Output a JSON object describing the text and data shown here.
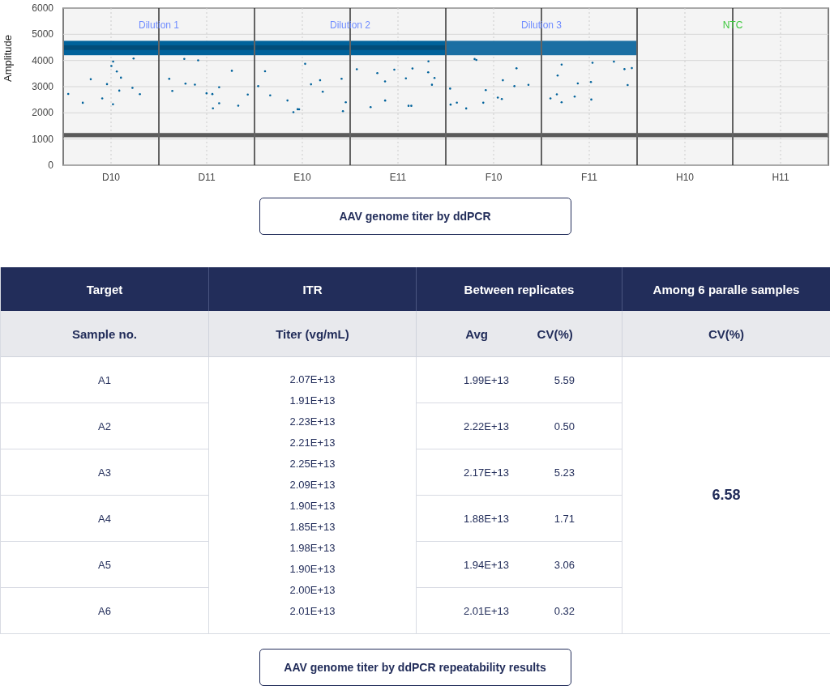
{
  "chart": {
    "ylabel": "Amplitude",
    "yticks": [
      "6000",
      "5000",
      "4000",
      "3000",
      "2000",
      "1000",
      "0"
    ],
    "wells": [
      {
        "label": "D10",
        "positive": true
      },
      {
        "label": "D11",
        "positive": true
      },
      {
        "label": "E10",
        "positive": true
      },
      {
        "label": "E11",
        "positive": true
      },
      {
        "label": "F10",
        "positive": true
      },
      {
        "label": "F11",
        "positive": true
      },
      {
        "label": "H10",
        "positive": false
      },
      {
        "label": "H11",
        "positive": false
      }
    ],
    "groups": [
      {
        "label": "Dilution 1",
        "color": "#6f8cff"
      },
      {
        "label": "Dilution 2",
        "color": "#6f8cff"
      },
      {
        "label": "Dilution 3",
        "color": "#6f8cff"
      },
      {
        "label": "NTC",
        "color": "#3cc83c"
      }
    ],
    "caption": "AAV genome titer by ddPCR"
  },
  "table": {
    "header": [
      "Target",
      "ITR",
      "Between replicates",
      "Among 6 paralle samples"
    ],
    "subheader": {
      "sample": "Sample no.",
      "titer": "Titer (vg/mL)",
      "avg": "Avg",
      "cv": "CV(%)",
      "overall_cv": "CV(%)"
    },
    "rows": [
      {
        "sample": "A1",
        "avg": "1.99E+13",
        "cv": "5.59"
      },
      {
        "sample": "A2",
        "avg": "2.22E+13",
        "cv": "0.50"
      },
      {
        "sample": "A3",
        "avg": "2.17E+13",
        "cv": "5.23"
      },
      {
        "sample": "A4",
        "avg": "1.88E+13",
        "cv": "1.71"
      },
      {
        "sample": "A5",
        "avg": "1.94E+13",
        "cv": "3.06"
      },
      {
        "sample": "A6",
        "avg": "2.01E+13",
        "cv": "0.32"
      }
    ],
    "titers": [
      "2.07E+13",
      "1.91E+13",
      "2.23E+13",
      "2.21E+13",
      "2.25E+13",
      "2.09E+13",
      "1.90E+13",
      "1.85E+13",
      "1.98E+13",
      "1.90E+13",
      "2.00E+13",
      "2.01E+13"
    ],
    "overall_cv": "6.58",
    "caption": "AAV genome titer by ddPCR repeatability results"
  }
}
